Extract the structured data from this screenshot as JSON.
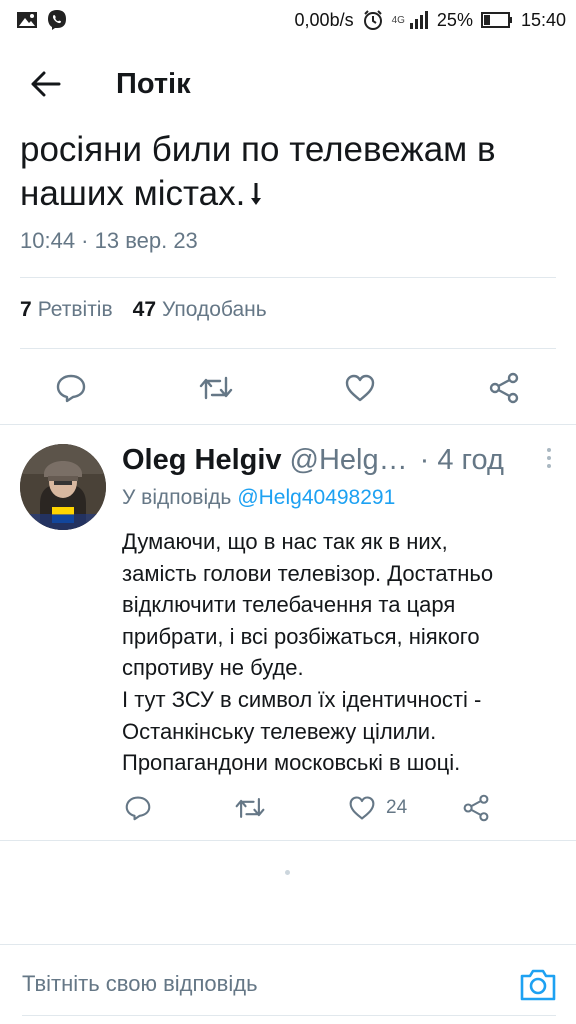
{
  "status_bar": {
    "network_speed": "0,00b/s",
    "network_type": "4G",
    "battery": "25%",
    "time": "15:40"
  },
  "header": {
    "title": "Потік"
  },
  "tweet": {
    "text_line1": "росіяни били по телевежам в",
    "text_line2": "наших містах.",
    "timestamp": "10:44 · 13 вер. 23",
    "retweets_count": "7",
    "retweets_label": "Ретвітів",
    "likes_count": "47",
    "likes_label": "Уподобань"
  },
  "reply": {
    "author_name": "Oleg Helgiv",
    "author_handle": "@Helg…",
    "time": "· 4 год",
    "reply_to_label": "У відповідь",
    "reply_to_handle": "@Helg40498291",
    "body": "Думаючи, що в нас так як в них,\nзамість голови телевізор. Достатньо\nвідключити телебачення та царя\nприбрати, і всі розбіжаться, ніякого\nспротиву не буде.\nІ тут ЗСУ в символ їх ідентичності -\nОстанкінську телевежу цілили.\nПропагандони московські в шоці.",
    "likes_count": "24"
  },
  "compose": {
    "placeholder": "Твітніть свою відповідь"
  },
  "colors": {
    "accent": "#1da1f2",
    "secondary_text": "#657786",
    "icon": "#657786",
    "divider": "#e1e8ed"
  }
}
